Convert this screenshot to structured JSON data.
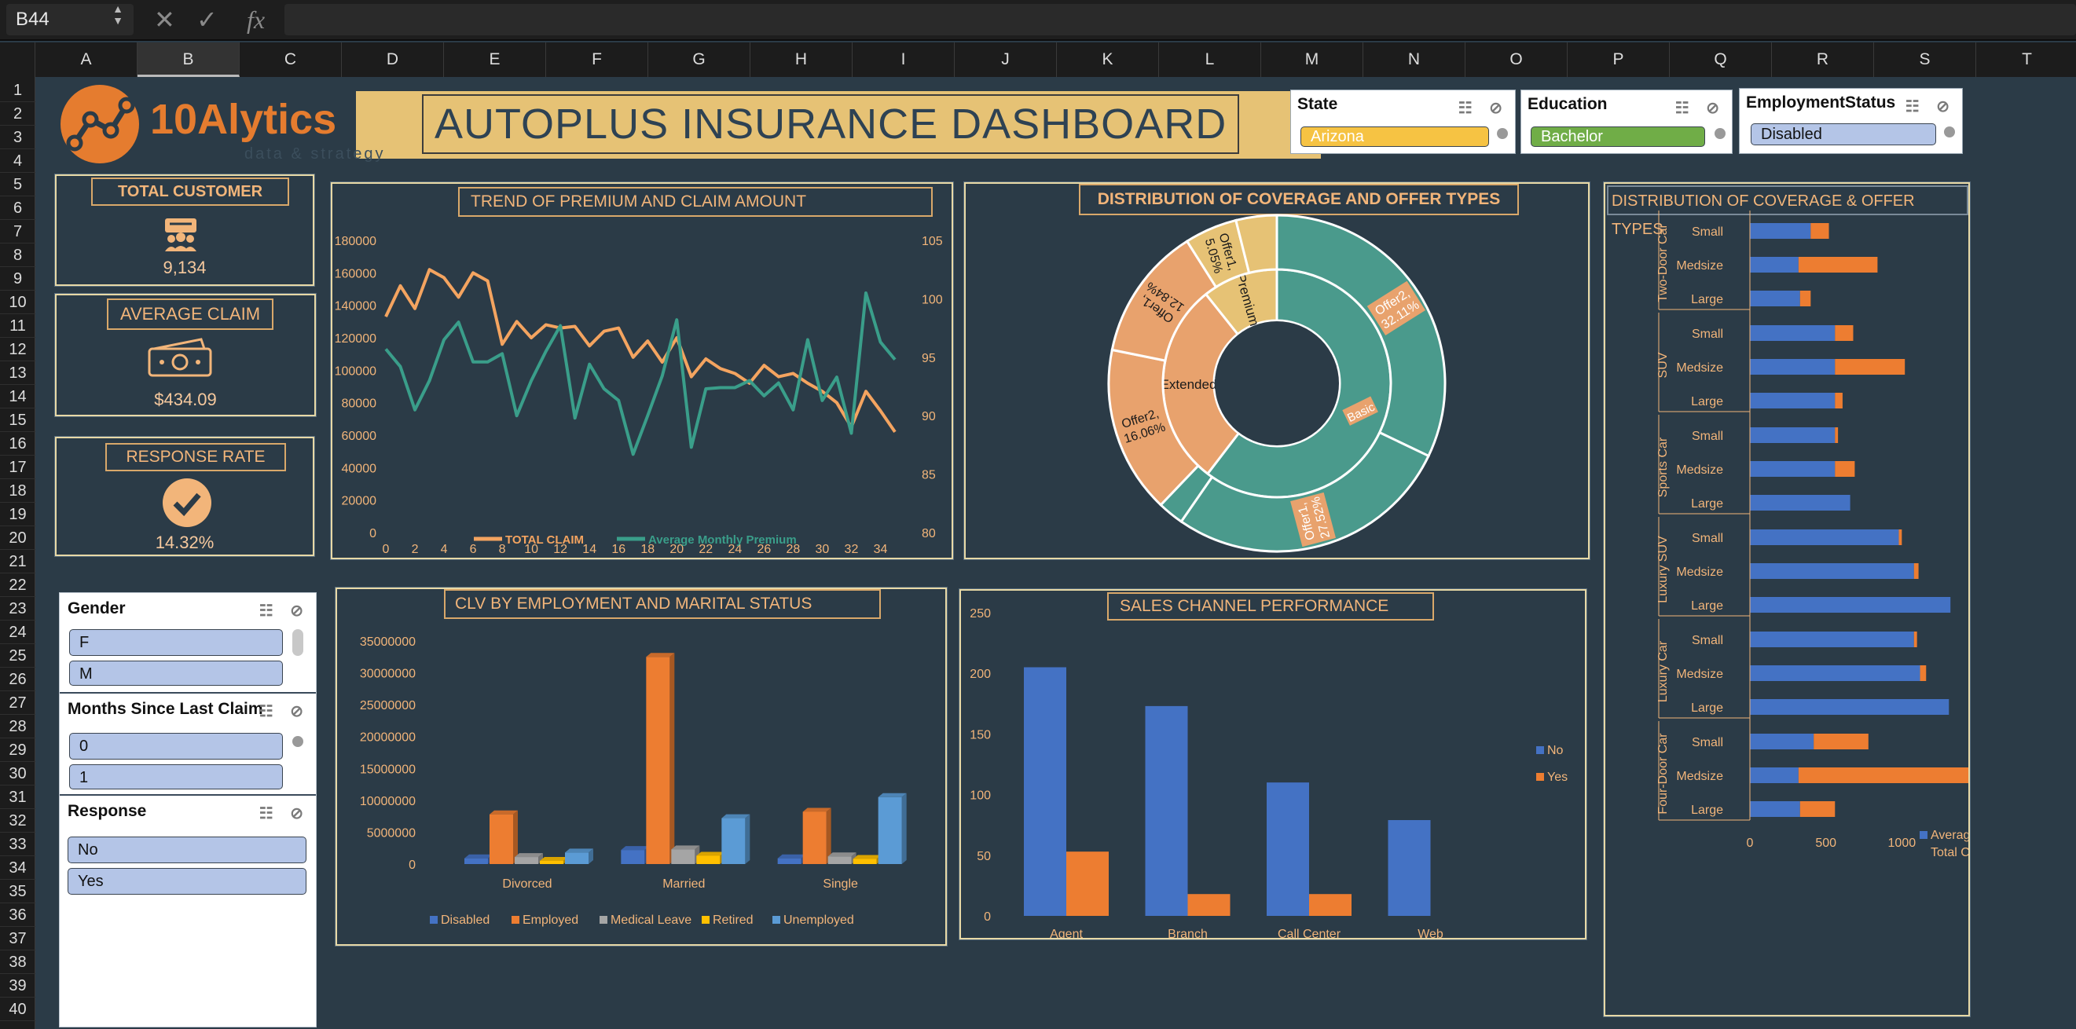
{
  "formula_bar": {
    "name_box": "B44",
    "cancel_icon": "✕",
    "enter_icon": "✓",
    "fx_icon": "fx",
    "value": ""
  },
  "columns": [
    "A",
    "B",
    "C",
    "D",
    "E",
    "F",
    "G",
    "H",
    "I",
    "J",
    "K",
    "L",
    "M",
    "N",
    "O",
    "P",
    "Q",
    "R",
    "S",
    "T"
  ],
  "rows": [
    "1",
    "2",
    "3",
    "4",
    "5",
    "6",
    "7",
    "8",
    "9",
    "10",
    "11",
    "12",
    "13",
    "14",
    "15",
    "16",
    "17",
    "18",
    "19",
    "20",
    "21",
    "22",
    "23",
    "24",
    "25",
    "26",
    "27",
    "28",
    "29",
    "30",
    "31",
    "32",
    "33",
    "34",
    "35",
    "36",
    "37",
    "38",
    "39",
    "40"
  ],
  "selected_column": "B",
  "logo": {
    "name": "10Alytics",
    "tagline": "data & strategy"
  },
  "dashboard_title": "AUTOPLUS INSURANCE DASHBOARD",
  "slicers_top": [
    {
      "title": "State",
      "selected": "Arizona",
      "color": "#f6c343"
    },
    {
      "title": "Education",
      "selected": "Bachelor",
      "color": "#70ad47"
    },
    {
      "title": "EmploymentStatus",
      "selected": "Disabled",
      "color": "#b4c5e7"
    }
  ],
  "kpis": {
    "total_customer": {
      "label": "TOTAL  CUSTOMER",
      "value": "9,134",
      "icon": "customers-icon"
    },
    "average_claim": {
      "label": "AVERAGE CLAIM",
      "value": "$434.09",
      "icon": "cash-icon"
    },
    "response_rate": {
      "label": "RESPONSE RATE",
      "value": "14.32%",
      "icon": "check-circle-icon"
    }
  },
  "slicers_left": [
    {
      "title": "Gender",
      "items": [
        "F",
        "M"
      ]
    },
    {
      "title": "Months Since Last Claim",
      "items": [
        "0",
        "1"
      ]
    },
    {
      "title": "Response",
      "items": [
        "No",
        "Yes"
      ]
    }
  ],
  "chart_data": [
    {
      "type": "line",
      "title": "TREND OF PREMIUM AND CLAIM AMOUNT",
      "x": [
        0,
        1,
        2,
        3,
        4,
        5,
        6,
        7,
        8,
        9,
        10,
        11,
        12,
        13,
        14,
        15,
        16,
        17,
        18,
        19,
        20,
        21,
        22,
        23,
        24,
        25,
        26,
        27,
        28,
        29,
        30,
        31,
        32,
        33,
        34,
        35
      ],
      "x_ticks": [
        "0",
        "2",
        "4",
        "6",
        "8",
        "10",
        "12",
        "14",
        "16",
        "18",
        "20",
        "22",
        "24",
        "26",
        "28",
        "30",
        "32",
        "34"
      ],
      "y_left_ticks": [
        "0",
        "20000",
        "40000",
        "60000",
        "80000",
        "100000",
        "120000",
        "140000",
        "160000",
        "180000"
      ],
      "y_right_ticks": [
        "80",
        "85",
        "90",
        "95",
        "100",
        "105"
      ],
      "ylim_left": [
        0,
        180000
      ],
      "ylim_right": [
        80,
        105
      ],
      "series": [
        {
          "name": "TOTAL CLAIM",
          "axis": "left",
          "color": "#f4a460",
          "values": [
            133000,
            152000,
            138000,
            162000,
            157000,
            145000,
            160000,
            155000,
            116000,
            130000,
            120000,
            128000,
            126000,
            127000,
            115000,
            124000,
            126000,
            108000,
            118000,
            105000,
            120000,
            96000,
            107000,
            101000,
            98000,
            92000,
            103000,
            96000,
            98000,
            92000,
            87000,
            80000,
            65000,
            87000,
            75000,
            62000
          ]
        },
        {
          "name": "Average Monthly Premium",
          "axis": "right",
          "color": "#3a9e8a",
          "values": [
            95.7,
            94.2,
            90.5,
            93.0,
            96.5,
            98.0,
            94.6,
            94.6,
            95.3,
            90.0,
            93.0,
            95.5,
            97.7,
            89.8,
            94.4,
            92.3,
            91.3,
            86.7,
            90.0,
            93.4,
            98.2,
            87.3,
            92.3,
            92.4,
            92.4,
            93.0,
            91.7,
            92.8,
            90.5,
            96.5,
            91.3,
            93.3,
            88.5,
            100.5,
            96.3,
            94.8
          ]
        }
      ]
    },
    {
      "type": "pie",
      "subtype": "sunburst",
      "title": "DISTRIBUTION OF COVERAGE AND OFFER TYPES",
      "inner": [
        {
          "label": "Basic",
          "value": 60.4,
          "color": "#4a9a8c"
        },
        {
          "label": "Extended",
          "value": 28.9,
          "color": "#e8a26d"
        },
        {
          "label": "Premium",
          "value": 10.7,
          "color": "#e6c275"
        }
      ],
      "outer": [
        {
          "label": "Offer2, 32.11%",
          "value": 32.11,
          "color": "#4a9a8c"
        },
        {
          "label": "Offer1, 27.52%",
          "value": 27.52,
          "color": "#4a9a8c"
        },
        {
          "label": "",
          "value": 2.5,
          "color": "#4a9a8c"
        },
        {
          "label": "Offer2, 16.06%",
          "value": 16.06,
          "color": "#e8a26d"
        },
        {
          "label": "Offer1, 12.84%",
          "value": 12.84,
          "color": "#e8a26d"
        },
        {
          "label": "Offer1, 5.05%",
          "value": 5.05,
          "color": "#e6c275"
        },
        {
          "label": "",
          "value": 3.92,
          "color": "#e6c275"
        }
      ]
    },
    {
      "type": "bar",
      "orientation": "horizontal",
      "stacked": true,
      "title": "DISTRIBUTION OF COVERAGE & OFFER TYPES",
      "groups": [
        "Two-Door Car",
        "SUV",
        "Sports Car",
        "Luxury SUV",
        "Luxury Car",
        "Four-Door Car"
      ],
      "categories": [
        "Small",
        "Medsize",
        "Large"
      ],
      "x_ticks": [
        "0",
        "500",
        "1000"
      ],
      "xlim": [
        0,
        1500
      ],
      "legend": "Average of Total Claim Amount",
      "series": [
        {
          "name": "Average of Total Claim Amount",
          "color": "#4472c4",
          "values": [
            [
              400,
              320,
              330
            ],
            [
              560,
              560,
              560
            ],
            [
              560,
              560,
              660
            ],
            [
              980,
              1080,
              1320
            ],
            [
              1080,
              1120,
              1310
            ],
            [
              420,
              320,
              330
            ]
          ]
        },
        {
          "name": "",
          "color": "#ed7d31",
          "values": [
            [
              120,
              520,
              70
            ],
            [
              120,
              460,
              50
            ],
            [
              20,
              130,
              0
            ],
            [
              20,
              30,
              0
            ],
            [
              20,
              40,
              0
            ],
            [
              360,
              1250,
              230
            ]
          ]
        }
      ]
    },
    {
      "type": "bar",
      "subtype": "3d-clustered",
      "title": "CLV BY EMPLOYMENT AND MARITAL STATUS",
      "categories": [
        "Divorced",
        "Married",
        "Single"
      ],
      "y_ticks": [
        "0",
        "5000000",
        "10000000",
        "15000000",
        "20000000",
        "25000000",
        "30000000",
        "35000000"
      ],
      "ylim": [
        0,
        35000000
      ],
      "series": [
        {
          "name": "Disabled",
          "color": "#4472c4",
          "values": [
            900000,
            2200000,
            900000
          ]
        },
        {
          "name": "Employed",
          "color": "#ed7d31",
          "values": [
            7800000,
            32500000,
            8200000
          ]
        },
        {
          "name": "Medical Leave",
          "color": "#a5a5a5",
          "values": [
            1100000,
            2300000,
            1200000
          ]
        },
        {
          "name": "Retired",
          "color": "#ffc000",
          "values": [
            500000,
            1300000,
            800000
          ]
        },
        {
          "name": "Unemployed",
          "color": "#5b9bd5",
          "values": [
            1800000,
            7200000,
            10500000
          ]
        }
      ]
    },
    {
      "type": "bar",
      "title": "SALES CHANNEL PERFORMANCE",
      "categories": [
        "Agent",
        "Branch",
        "Call Center",
        "Web"
      ],
      "y_ticks": [
        "0",
        "50",
        "100",
        "150",
        "200",
        "250"
      ],
      "ylim": [
        0,
        250
      ],
      "series": [
        {
          "name": "No",
          "color": "#4472c4",
          "values": [
            205,
            173,
            110,
            79
          ]
        },
        {
          "name": "Yes",
          "color": "#ed7d31",
          "values": [
            53,
            18,
            18,
            0
          ]
        }
      ]
    }
  ]
}
